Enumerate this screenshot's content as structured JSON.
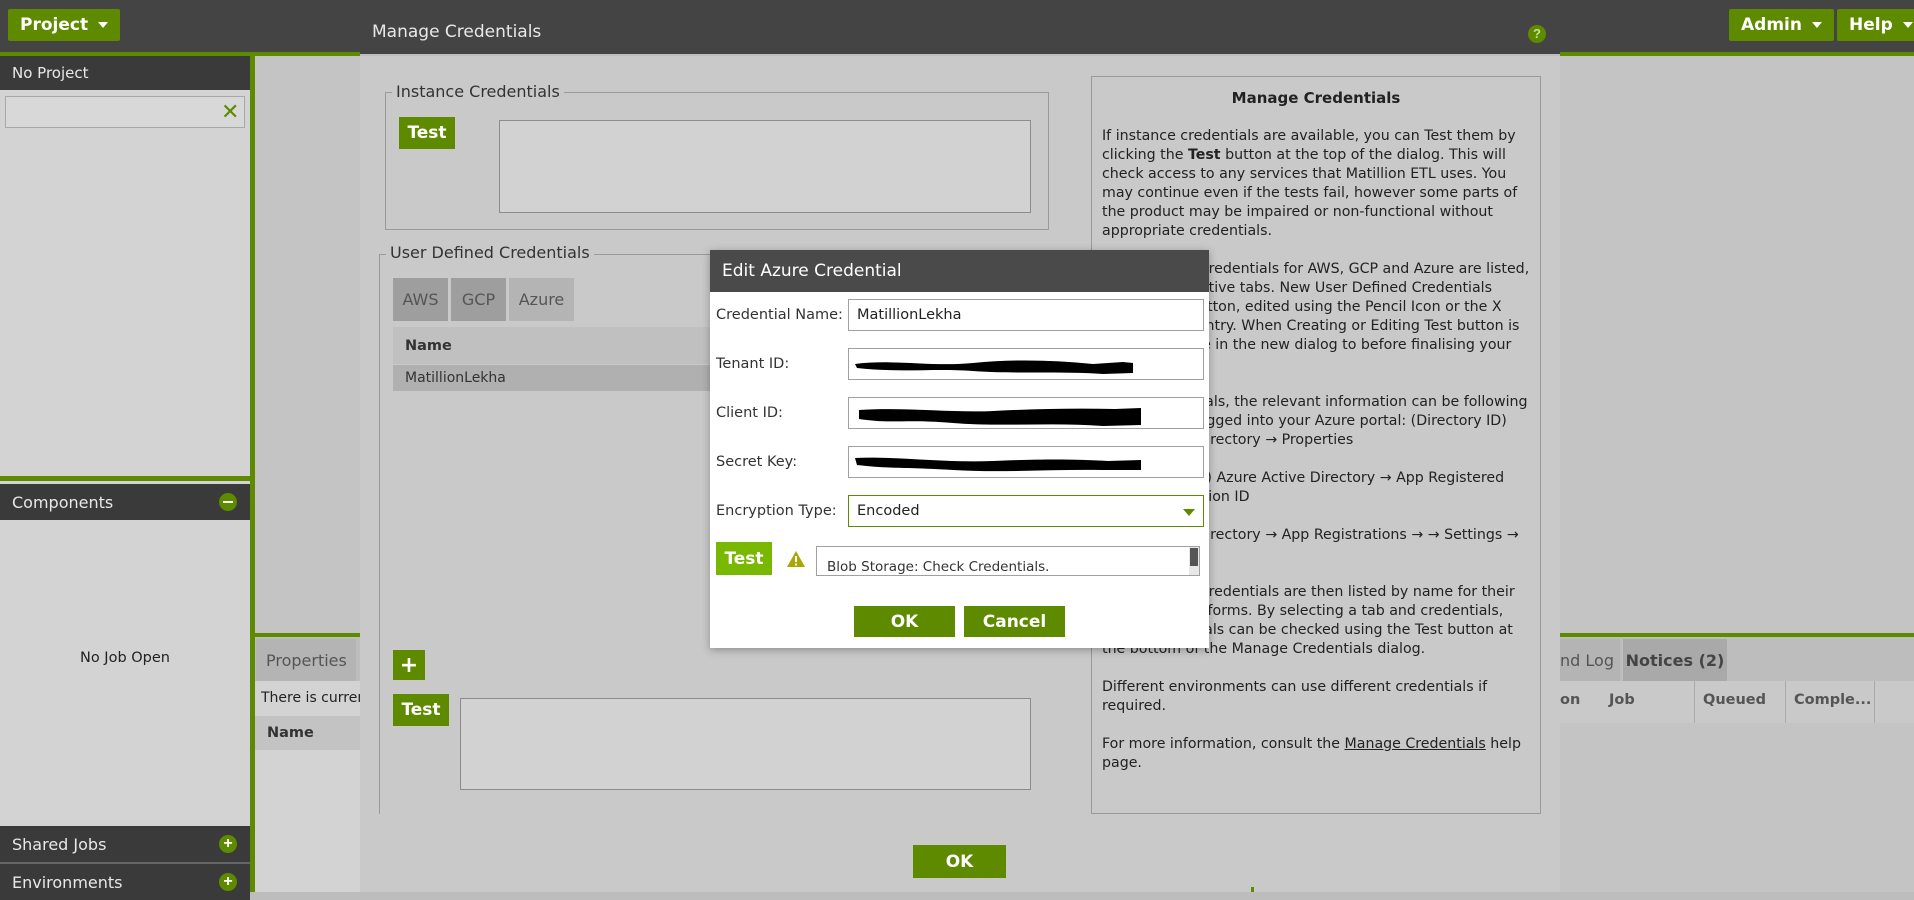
{
  "topbar": {
    "project_label": "Project",
    "dialog_title": "Manage Credentials",
    "admin_label": "Admin",
    "help_label": "Help",
    "help_icon": "question-circle-icon"
  },
  "sidebar": {
    "project_header": "No Project",
    "components_header": "Components",
    "no_job_text": "No Job Open",
    "shared_jobs": "Shared Jobs",
    "environments": "Environments"
  },
  "properties": {
    "tab_label": "Properties",
    "info_text": "There is current",
    "column_name": "Name"
  },
  "right_tabs": {
    "log_tab": "nd Log",
    "notices_tab": "Notices (2)",
    "columns": [
      "on",
      "Job",
      "Queued",
      "Comple..."
    ]
  },
  "manage_credentials": {
    "instance_legend": "Instance Credentials",
    "instance_test": "Test",
    "user_defined_legend": "User Defined Credentials",
    "tabs": [
      "AWS",
      "GCP",
      "Azure"
    ],
    "table_header": "Name",
    "table_rows": [
      "MatillionLekha"
    ],
    "add_symbol": "+",
    "bottom_test": "Test",
    "ok_label": "OK"
  },
  "help_panel": {
    "title": "Manage Credentials",
    "p1_a": "If instance credentials are available, you can Test them by clicking the ",
    "p1_b": "Test",
    "p1_c": " button at the top of the dialog. This will check access to any services that Matillion ETL uses. You may continue even if the tests fail, however some parts of the product may be impaired or non-functional without appropriate credentials.",
    "p2": "User Defined Credentials for AWS, GCP and Azure are listed, by their respective tabs. New User Defined Credentials using the + button, edited using the Pencil Icon or the X Icon by each entry. When Creating or Editing Test button is made available in the new dialog to before finalising your credentials.",
    "p3": "Azure credentials, the relevant information can be following places while logged into your Azure portal: (Directory ID) Azure Active Directory → Properties",
    "p4": "(Application ID) Azure Active Directory → App Registered App → Application ID",
    "p5": "Azure Active Directory → App Registrations → → Settings → Keys",
    "p6": "User Defined Credentials are then listed by name for their respective platforms. By selecting a tab and credentials, those credentials can be checked using the Test button at the bottom of the Manage Credentials dialog.",
    "p7": "Different environments can use different credentials if required.",
    "p8_a": "For more information, consult the ",
    "p8_link": "Manage Credentials",
    "p8_b": " help page."
  },
  "modal": {
    "title": "Edit Azure Credential",
    "credential_name_label": "Credential Name:",
    "credential_name_value": "MatillionLekha",
    "tenant_id_label": "Tenant ID:",
    "client_id_label": "Client ID:",
    "secret_key_label": "Secret Key:",
    "encryption_type_label": "Encryption Type:",
    "encryption_type_value": "Encoded",
    "test_label": "Test",
    "test_result": "Blob Storage: Check Credentials.",
    "ok_label": "OK",
    "cancel_label": "Cancel"
  },
  "colors": {
    "brand_green": "#5e8a00",
    "bright_green": "#78b800",
    "dark_bar": "#444444",
    "warning": "#7a7a00"
  }
}
